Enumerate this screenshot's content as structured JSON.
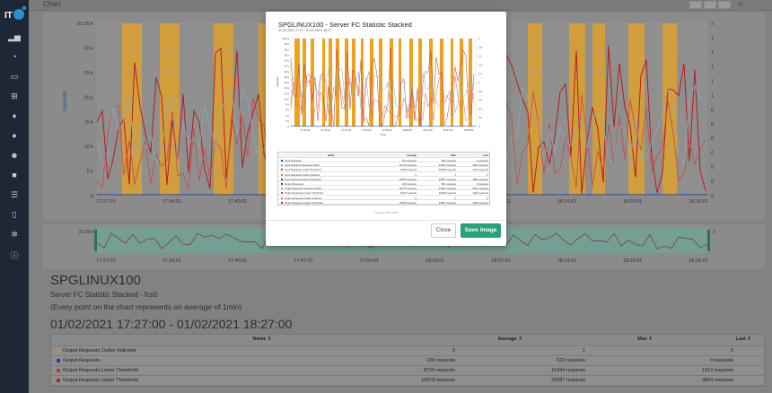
{
  "brand": {
    "logo_text": "IT"
  },
  "sidebar": {
    "icons": [
      "chart-line-icon",
      "dashboard-icon",
      "monitor-icon",
      "sitemap-icon",
      "bell-icon",
      "info-icon",
      "users-icon",
      "lock-icon",
      "server-icon",
      "document-icon",
      "cogs-icon",
      "info-circle-icon"
    ]
  },
  "header": {
    "title": "Chart"
  },
  "main_chart": {
    "ylabel": "requests",
    "yticks": [
      "32.55 k",
      "30 k",
      "25 k",
      "20 k",
      "15 k",
      "10 k",
      "5 k",
      "0"
    ],
    "y2ticks": [
      "2",
      "1",
      "1",
      "1",
      "1",
      "1",
      "0",
      "0",
      "0",
      "0",
      "0",
      "0",
      "0"
    ],
    "xticks": [
      "17:27:01",
      "17:34:01",
      "17:40:01",
      "17:47:01",
      "17:54:01",
      "18:00:01",
      "18:07:01",
      "18:14:02",
      "18:20:01",
      "18:26:01"
    ]
  },
  "navigator": {
    "ytick": "32.59 k",
    "y2tick": "2",
    "xticks": [
      "17:27:01",
      "17:34:01",
      "17:40:01",
      "17:47:01",
      "17:54:01",
      "18:00:01",
      "18:07:01",
      "18:14:02",
      "18:20:01",
      "18:26:01"
    ]
  },
  "info": {
    "host": "SPGLINUX100",
    "subtitle": "Server FC Statistic Stacked - fcs0",
    "note": "(Every point on the chart represents an average of 1min)",
    "range": "01/02/2021 17:27:00 - 01/02/2021 18:27:00"
  },
  "table": {
    "headers": {
      "name": "Name",
      "average": "Average",
      "max": "Max",
      "last": "Last"
    },
    "rows": [
      {
        "name": "Output Requests Outlier Indicator",
        "average": "0",
        "max": "1",
        "last": "0",
        "color": "#e08a1e"
      },
      {
        "name": "Output Requests",
        "average": "109 requests",
        "max": "522 requests",
        "last": "0 requests",
        "color": "#1f3fb0"
      },
      {
        "name": "Output Requests Lower Threshold",
        "average": "8716 requests",
        "max": "16294 requests",
        "last": "1612 requests",
        "color": "#c0392b"
      },
      {
        "name": "Output Requests Upper Threshold",
        "average": "16878 requests",
        "max": "32587 requests",
        "last": "4834 requests",
        "color": "#b02020"
      }
    ]
  },
  "modal": {
    "title": "SPGLINUX100 - Server FC Statistic Stacked",
    "subtitle": "01.02.2021 17:27 - 01.02.2021 18:27",
    "copyright": "Copyright ITPS 2020",
    "close_label": "Close",
    "save_label": "Save image",
    "chart_ylabel": "requests",
    "chart_xlabel": "Time",
    "chart_yticks": [
      "32.5 k",
      "30 k",
      "28 k",
      "26 k",
      "24 k",
      "22 k",
      "20 k",
      "18 k",
      "16 k",
      "14 k",
      "12 k",
      "10 k",
      "8 k",
      "6 k",
      "4 k",
      "2 k",
      "0"
    ],
    "chart_y2ticks": [
      "2",
      "1.8",
      "1.6",
      "1.4",
      "1.2",
      "1",
      "0.8",
      "0.6",
      "0.4",
      "0.2",
      "0"
    ],
    "chart_xticks": [
      "17:35:01",
      "17:41:01",
      "17:47:01",
      "17:53:01",
      "17:59:01",
      "18:05:01",
      "18:11:01",
      "18:17:01",
      "18:23:01"
    ],
    "table_headers": {
      "name": "Name",
      "average": "Average",
      "max": "Max",
      "last": "Last"
    },
    "table_rows": [
      {
        "name": "Input Requests",
        "average": "100 requests",
        "max": "521 requests",
        "last": "0 requests",
        "color": "#1f3fb0"
      },
      {
        "name": "Input Requests Expected Value",
        "average": "12175 requests",
        "max": "24441 requests",
        "last": "3221 requests",
        "color": "#7fa6c9"
      },
      {
        "name": "Input Requests Lower Threshold",
        "average": "8142 requests",
        "max": "16294 requests",
        "last": "1612 requests",
        "color": "#c0392b"
      },
      {
        "name": "Input Requests Outlier Indicator",
        "average": "0",
        "max": "1",
        "last": "0",
        "color": "#e08a1e"
      },
      {
        "name": "Input Requests Upper Threshold",
        "average": "16878 requests",
        "max": "32587 requests",
        "last": "4834 requests",
        "color": "#b02020"
      },
      {
        "name": "Output Requests",
        "average": "100 requests",
        "max": "521 requests",
        "last": "0 requests",
        "color": "#1f3fb0"
      },
      {
        "name": "Output Requests Expected Value",
        "average": "12175 requests",
        "max": "24441 requests",
        "last": "3221 requests",
        "color": "#7fa6c9"
      },
      {
        "name": "Output Requests Lower Threshold",
        "average": "8142 requests",
        "max": "16294 requests",
        "last": "1612 requests",
        "color": "#c0392b"
      },
      {
        "name": "Output Requests Outlier Indicator",
        "average": "0",
        "max": "1",
        "last": "0",
        "color": "#e08a1e"
      },
      {
        "name": "Output Requests Upper Threshold",
        "average": "16878 requests",
        "max": "32587 requests",
        "last": "4834 requests",
        "color": "#b02020"
      }
    ]
  },
  "colors": {
    "outlier": "#e2a126",
    "upper": "#b81c1c",
    "lower": "#c44a4a",
    "expected": "#8fa8b8",
    "requests": "#1f3fb0",
    "accent": "#27a27a"
  }
}
